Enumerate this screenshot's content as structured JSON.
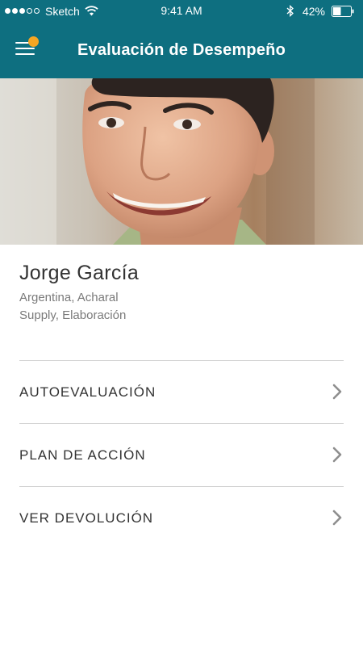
{
  "status_bar": {
    "carrier": "Sketch",
    "time": "9:41 AM",
    "battery": "42%",
    "icons": [
      "signal-icon",
      "wifi-icon",
      "bluetooth-icon",
      "battery-icon"
    ]
  },
  "header": {
    "title": "Evaluación de Desempeño",
    "menu_icon": "hamburger-menu-icon",
    "has_notification": true
  },
  "profile": {
    "name": "Jorge García",
    "location": "Argentina, Acharal",
    "department": "Supply, Elaboración"
  },
  "menu": {
    "items": [
      {
        "label": "AUTOEVALUACIÓN",
        "icon": "chevron-right-icon"
      },
      {
        "label": "PLAN DE ACCIÓN",
        "icon": "chevron-right-icon"
      },
      {
        "label": "VER DEVOLUCIÓN",
        "icon": "chevron-right-icon"
      }
    ]
  },
  "colors": {
    "primary": "#0e6f80",
    "notification": "#f5a623",
    "text": "#333333",
    "subtext": "#7a7a7a",
    "divider": "#d3d3d3"
  }
}
